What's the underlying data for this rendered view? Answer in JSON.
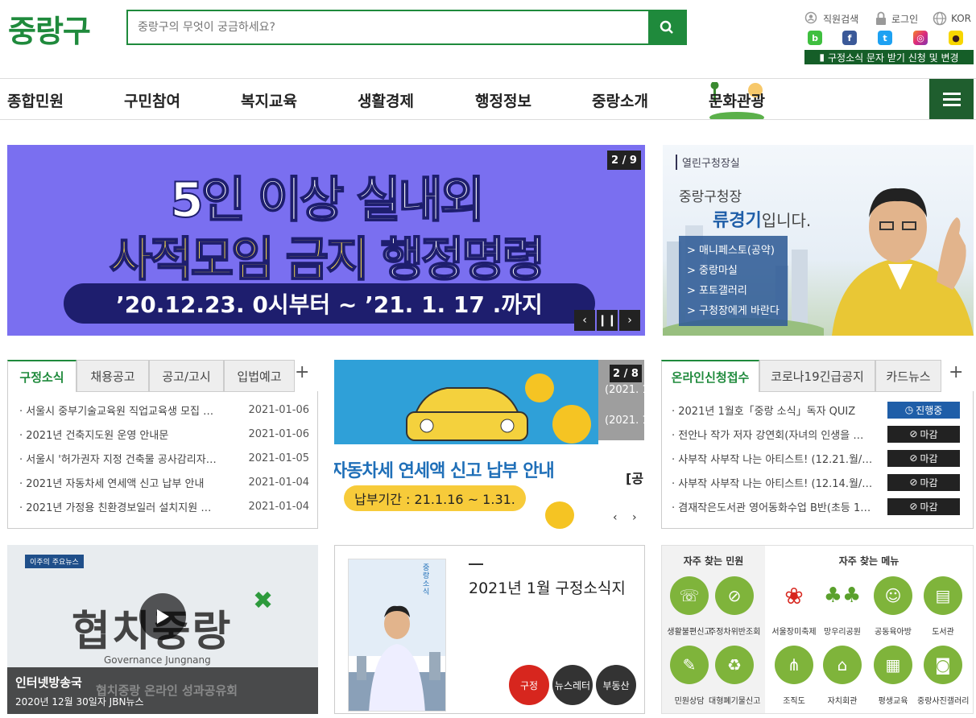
{
  "header": {
    "logo": "중랑구",
    "search_placeholder": "중랑구의 무엇이 궁금하세요?",
    "util": {
      "staff_search": "직원검색",
      "login": "로그인",
      "language": "KOR"
    },
    "sns": [
      "blog",
      "facebook",
      "twitter",
      "instagram",
      "kakao"
    ],
    "sms_label": "구정소식 문자 받기 신청 및 변경"
  },
  "nav": {
    "items": [
      "종합민원",
      "구민참여",
      "복지교육",
      "생활경제",
      "행정정보",
      "중랑소개",
      "문화관광"
    ]
  },
  "banner": {
    "line1": "5인 이상 실내외",
    "line2a": "사적모임 금지",
    "line2b": "행정명령",
    "line3": "’20.12.23. 0시부터 ~ ’21. 1. 17 .까지",
    "counter": "2 / 9"
  },
  "mayor": {
    "tag": "열린구청장실",
    "subtitle": "중랑구청장",
    "name": "류경기",
    "name_suffix": "입니다.",
    "links": [
      "> 매니페스토(공약)",
      "> 중랑마실",
      "> 포토갤러리",
      "> 구청장에게 바란다"
    ]
  },
  "news": {
    "tabs": [
      "구정소식",
      "채용공고",
      "공고/고시",
      "입법예고"
    ],
    "items": [
      {
        "title": "서울시 중부기술교육원 직업교육생 모집 …",
        "date": "2021-01-06"
      },
      {
        "title": "2021년 건축지도원 운영 안내문",
        "date": "2021-01-06"
      },
      {
        "title": "서울시 '허가권자 지정 건축물 공사감리자…",
        "date": "2021-01-05"
      },
      {
        "title": "2021년 자동차세 연세액 신고 납부 안내",
        "date": "2021-01-04"
      },
      {
        "title": "2021년 가정용 친환경보일러 설치지원 …",
        "date": "2021-01-04"
      }
    ]
  },
  "promo": {
    "counter": "2 / 8",
    "title": "자동차세 연세액 신고 납부 안내",
    "period": "납부기간 : 21.1.16 ~ 1.31.",
    "side_dates": [
      "(2021. 1.",
      "(2021. 1."
    ],
    "side_label": "[공"
  },
  "online": {
    "tabs": [
      "온라인신청접수",
      "코로나19긴급공지",
      "카드뉴스"
    ],
    "items": [
      {
        "title": "2021년 1월호「중랑 소식」독자 QUIZ",
        "status": "진행중",
        "active": true
      },
      {
        "title": "전안나 작가 저자 강연회(자녀의 인생을 …",
        "status": "마감",
        "active": false
      },
      {
        "title": "사부작 사부작 나는 아티스트! (12.21.월/…",
        "status": "마감",
        "active": false
      },
      {
        "title": "사부작 사부작 나는 아티스트! (12.14.월/…",
        "status": "마감",
        "active": false
      },
      {
        "title": "겸재작은도서관 영어동화수업 B반(초등 1…",
        "status": "마감",
        "active": false
      }
    ]
  },
  "video": {
    "top_tag": "이주의 주요뉴스",
    "big_text": "협치중랑",
    "sub_text": "Governance Jungnang",
    "caption_title": "인터넷방송국",
    "caption_overlay": "협치중랑 온라인 성과공유회",
    "caption_date": "2020년 12월 30일자 JBN뉴스"
  },
  "magazine": {
    "title": "2021년 1월 구정소식지",
    "cover_title": "중랑 소식",
    "buttons": [
      "구정",
      "뉴스레터",
      "부동산"
    ]
  },
  "quick": {
    "left_title": "자주 찾는 민원",
    "right_title": "자주 찾는 메뉴",
    "left_items": [
      "생활불편신고",
      "주정차위반조회",
      "민원상담",
      "대형폐기물신고"
    ],
    "right_items": [
      "서울장미축제",
      "망우리공원",
      "공동육아방",
      "도서관",
      "조직도",
      "자치회관",
      "평생교육",
      "중랑사진갤러리"
    ]
  },
  "colors": {
    "brand": "#1f8a3c",
    "banner_bg": "#7a6ff0",
    "active_badge": "#1f5ea8"
  }
}
